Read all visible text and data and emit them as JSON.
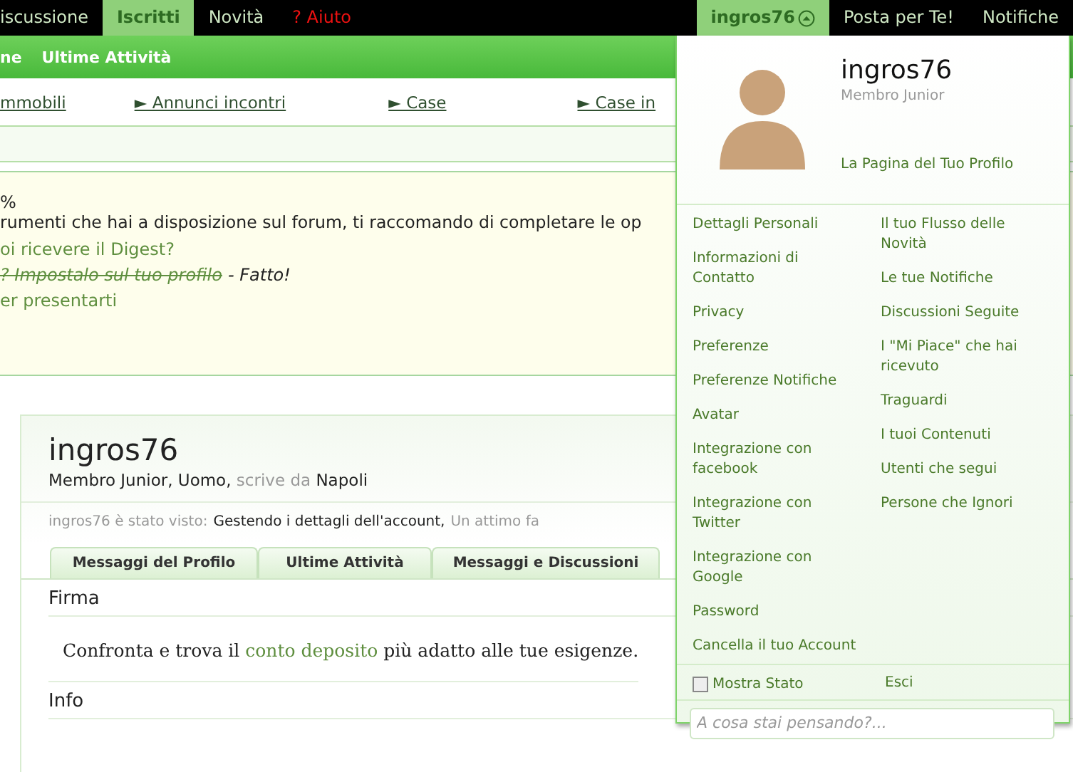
{
  "top_nav": {
    "tabs": [
      {
        "label": "iscussione",
        "selected": false,
        "kind": "normal"
      },
      {
        "label": "Iscritti",
        "selected": true,
        "kind": "normal"
      },
      {
        "label": "Novità",
        "selected": false,
        "kind": "normal"
      },
      {
        "label": "? Aiuto",
        "selected": false,
        "kind": "help"
      }
    ],
    "account_tabs": [
      {
        "label": "ingros76",
        "selected": true,
        "has_caret": true
      },
      {
        "label": "Posta per Te!",
        "selected": false,
        "has_caret": false
      },
      {
        "label": "Notifiche",
        "selected": false,
        "has_caret": false
      }
    ]
  },
  "sub_nav": [
    "ne",
    "Ultime Attività"
  ],
  "link_bar": [
    {
      "label": "mmobili"
    },
    {
      "label": "Annunci incontri",
      "arrow": "►"
    },
    {
      "label": "Case",
      "arrow": "►"
    },
    {
      "label": "Case in",
      "arrow": "►"
    }
  ],
  "notice": {
    "percent": "%",
    "text": "rumenti che hai a disposizione sul forum, ti raccomando di completare le op",
    "tasks": [
      {
        "label": "oi ricevere il Digest?",
        "done": false
      },
      {
        "label": "? Impostalo sul tuo profilo",
        "done": true,
        "suffix": "- Fatto!"
      },
      {
        "label": "er presentarti",
        "done": false
      }
    ]
  },
  "profile": {
    "name": "ingros76",
    "subtitle": "Membro Junior, Uomo, **scrive da** Napoli",
    "seen": {
      "label": "ingros76 è stato visto:",
      "activity": "Gestendo i dettagli dell'account,",
      "time": "Un attimo fa"
    },
    "tabs": [
      {
        "label": "Messaggi del Profilo",
        "selected": false
      },
      {
        "label": "Ultime Attività",
        "selected": false
      },
      {
        "label": "Messaggi e Discussioni",
        "selected": false
      }
    ],
    "signature": {
      "heading": "Firma",
      "before": "Confronta e trova il",
      "link": "conto deposito",
      "after": "più adatto alle tue esigenze."
    },
    "info_heading": "Info"
  },
  "account_menu": {
    "name": "ingros76",
    "title": "Membro Junior",
    "profile_link": "La Pagina del Tuo Profilo",
    "left_links": [
      "Dettagli Personali",
      "Informazioni di Contatto",
      "Privacy",
      "Preferenze",
      "Preferenze Notifiche",
      "Avatar",
      "Integrazione con facebook",
      "Integrazione con Twitter",
      "Integrazione con Google",
      "Password",
      "Cancella il tuo Account"
    ],
    "right_links": [
      "Il tuo Flusso delle Novità",
      "Le tue Notifiche",
      "Discussioni Seguite",
      "I \"Mi Piace\" che hai ricevuto",
      "Traguardi",
      "I tuoi Contenuti",
      "Utenti che segui",
      "Persone che Ignori"
    ],
    "show_status": {
      "label": "Mostra Stato",
      "checked": false
    },
    "logout": "Esci",
    "status_field": {
      "placeholder": "A cosa stai pensando?..."
    }
  }
}
